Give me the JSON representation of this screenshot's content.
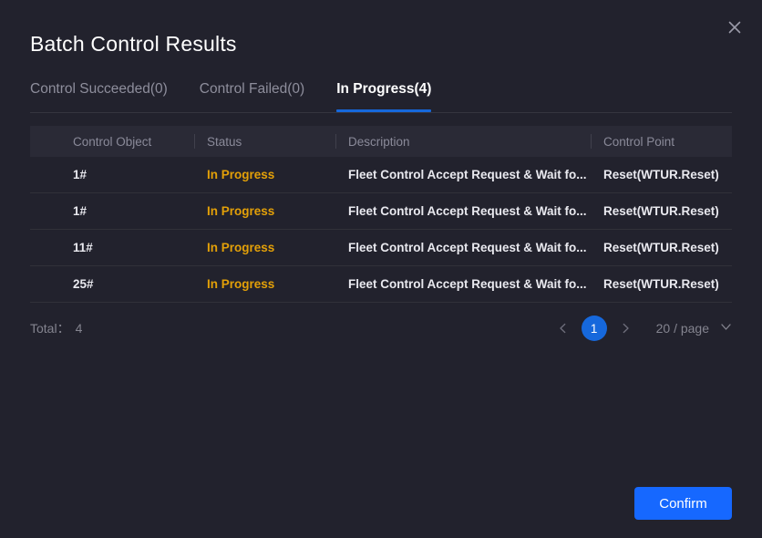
{
  "dialog": {
    "title": "Batch Control Results",
    "close_icon": "close-icon"
  },
  "tabs": [
    {
      "label": "Control Succeeded(0)",
      "active": false
    },
    {
      "label": "Control Failed(0)",
      "active": false
    },
    {
      "label": "In Progress(4)",
      "active": true
    }
  ],
  "table": {
    "columns": [
      "Control Object",
      "Status",
      "Description",
      "Control Point"
    ],
    "rows": [
      {
        "object": "1#",
        "status": "In Progress",
        "description": "Fleet Control Accept Request & Wait fo...",
        "control_point": "Reset(WTUR.Reset)"
      },
      {
        "object": "1#",
        "status": "In Progress",
        "description": "Fleet Control Accept Request & Wait fo...",
        "control_point": "Reset(WTUR.Reset)"
      },
      {
        "object": "11#",
        "status": "In Progress",
        "description": "Fleet Control Accept Request & Wait fo...",
        "control_point": "Reset(WTUR.Reset)"
      },
      {
        "object": "25#",
        "status": "In Progress",
        "description": "Fleet Control Accept Request & Wait fo...",
        "control_point": "Reset(WTUR.Reset)"
      }
    ]
  },
  "pagination": {
    "total_label": "Total：",
    "total_value": "4",
    "prev_icon": "chevron-left-icon",
    "next_icon": "chevron-right-icon",
    "current_page": "1",
    "page_size_label": "20 / page",
    "page_size_chevron": "chevron-down-icon"
  },
  "footer": {
    "confirm_label": "Confirm"
  },
  "colors": {
    "background": "#22222d",
    "accent_blue": "#1668ff",
    "tab_underline": "#1668dc",
    "status_orange": "#e3a008",
    "header_row": "#2a2a36",
    "muted_text": "#8a8a99"
  }
}
